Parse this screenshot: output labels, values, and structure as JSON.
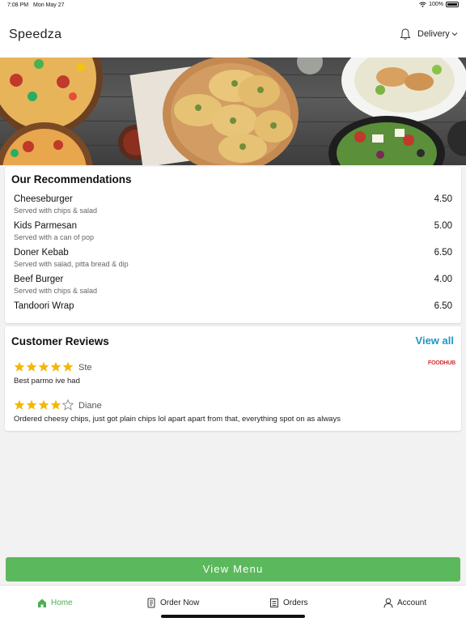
{
  "status_bar": {
    "time": "7:08 PM",
    "date": "Mon May 27",
    "battery": "100%"
  },
  "header": {
    "title": "Speedza",
    "delivery_label": "Delivery",
    "icons": [
      "bell-icon",
      "chevron-down-icon"
    ]
  },
  "recommendations": {
    "title": "Our Recommendations",
    "items": [
      {
        "name": "Cheeseburger",
        "description": "Served with chips & salad",
        "price": "4.50"
      },
      {
        "name": "Kids Parmesan",
        "description": "Served with a can of pop",
        "price": "5.00"
      },
      {
        "name": "Doner Kebab",
        "description": "Served with salad, pitta bread & dip",
        "price": "6.50"
      },
      {
        "name": "Beef Burger",
        "description": "Served with chips & salad",
        "price": "4.00"
      },
      {
        "name": "Tandoori Wrap",
        "description": "",
        "price": "6.50"
      }
    ]
  },
  "reviews": {
    "title": "Customer Reviews",
    "view_all": "View all",
    "brand": "FOODHUB",
    "items": [
      {
        "reviewer": "Ste",
        "rating": 5,
        "text": "Best parmo ive had"
      },
      {
        "reviewer": "Diane",
        "rating": 4,
        "text": "Ordered cheesy chips, just got plain chips lol apart apart from that, everything spot on as always"
      }
    ]
  },
  "view_menu_label": "View Menu",
  "tabs": [
    {
      "label": "Home",
      "icon": "home-icon",
      "active": true
    },
    {
      "label": "Order Now",
      "icon": "order-icon",
      "active": false
    },
    {
      "label": "Orders",
      "icon": "orders-icon",
      "active": false
    },
    {
      "label": "Account",
      "icon": "account-icon",
      "active": false
    }
  ],
  "colors": {
    "accent_green": "#5cb85c",
    "link_blue": "#2196c4",
    "star_yellow": "#f5b800",
    "brand_red": "#d32f2f"
  }
}
